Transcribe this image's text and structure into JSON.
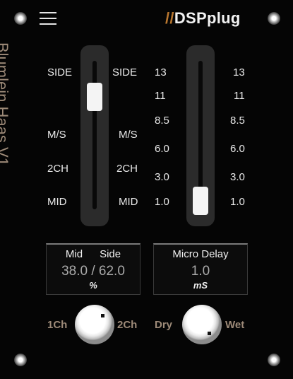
{
  "brand": {
    "slashes": "//",
    "name": "DSPplug"
  },
  "plugin_title": "Blumlein Haas V1",
  "width_fader": {
    "labels_left": [
      "SIDE",
      "M/S",
      "2CH",
      "MID"
    ],
    "labels_right": [
      "SIDE",
      "M/S",
      "2CH",
      "MID"
    ]
  },
  "delay_fader": {
    "scale_left": [
      "13",
      "11",
      "8.5",
      "6.0",
      "3.0",
      "1.0"
    ],
    "scale_right": [
      "13",
      "11",
      "8.5",
      "6.0",
      "3.0",
      "1.0"
    ]
  },
  "mix_display": {
    "label_mid": "Mid",
    "label_side": "Side",
    "value": "38.0 / 62.0",
    "unit": "%"
  },
  "delay_display": {
    "label": "Micro Delay",
    "value": "1.0",
    "unit": "mS"
  },
  "channel_knob": {
    "left_label": "1Ch",
    "right_label": "2Ch"
  },
  "wet_knob": {
    "left_label": "Dry",
    "right_label": "Wet"
  },
  "colors": {
    "accent_orange": "#b9772f",
    "label_tan": "#9d8a78",
    "background": "#050505"
  }
}
